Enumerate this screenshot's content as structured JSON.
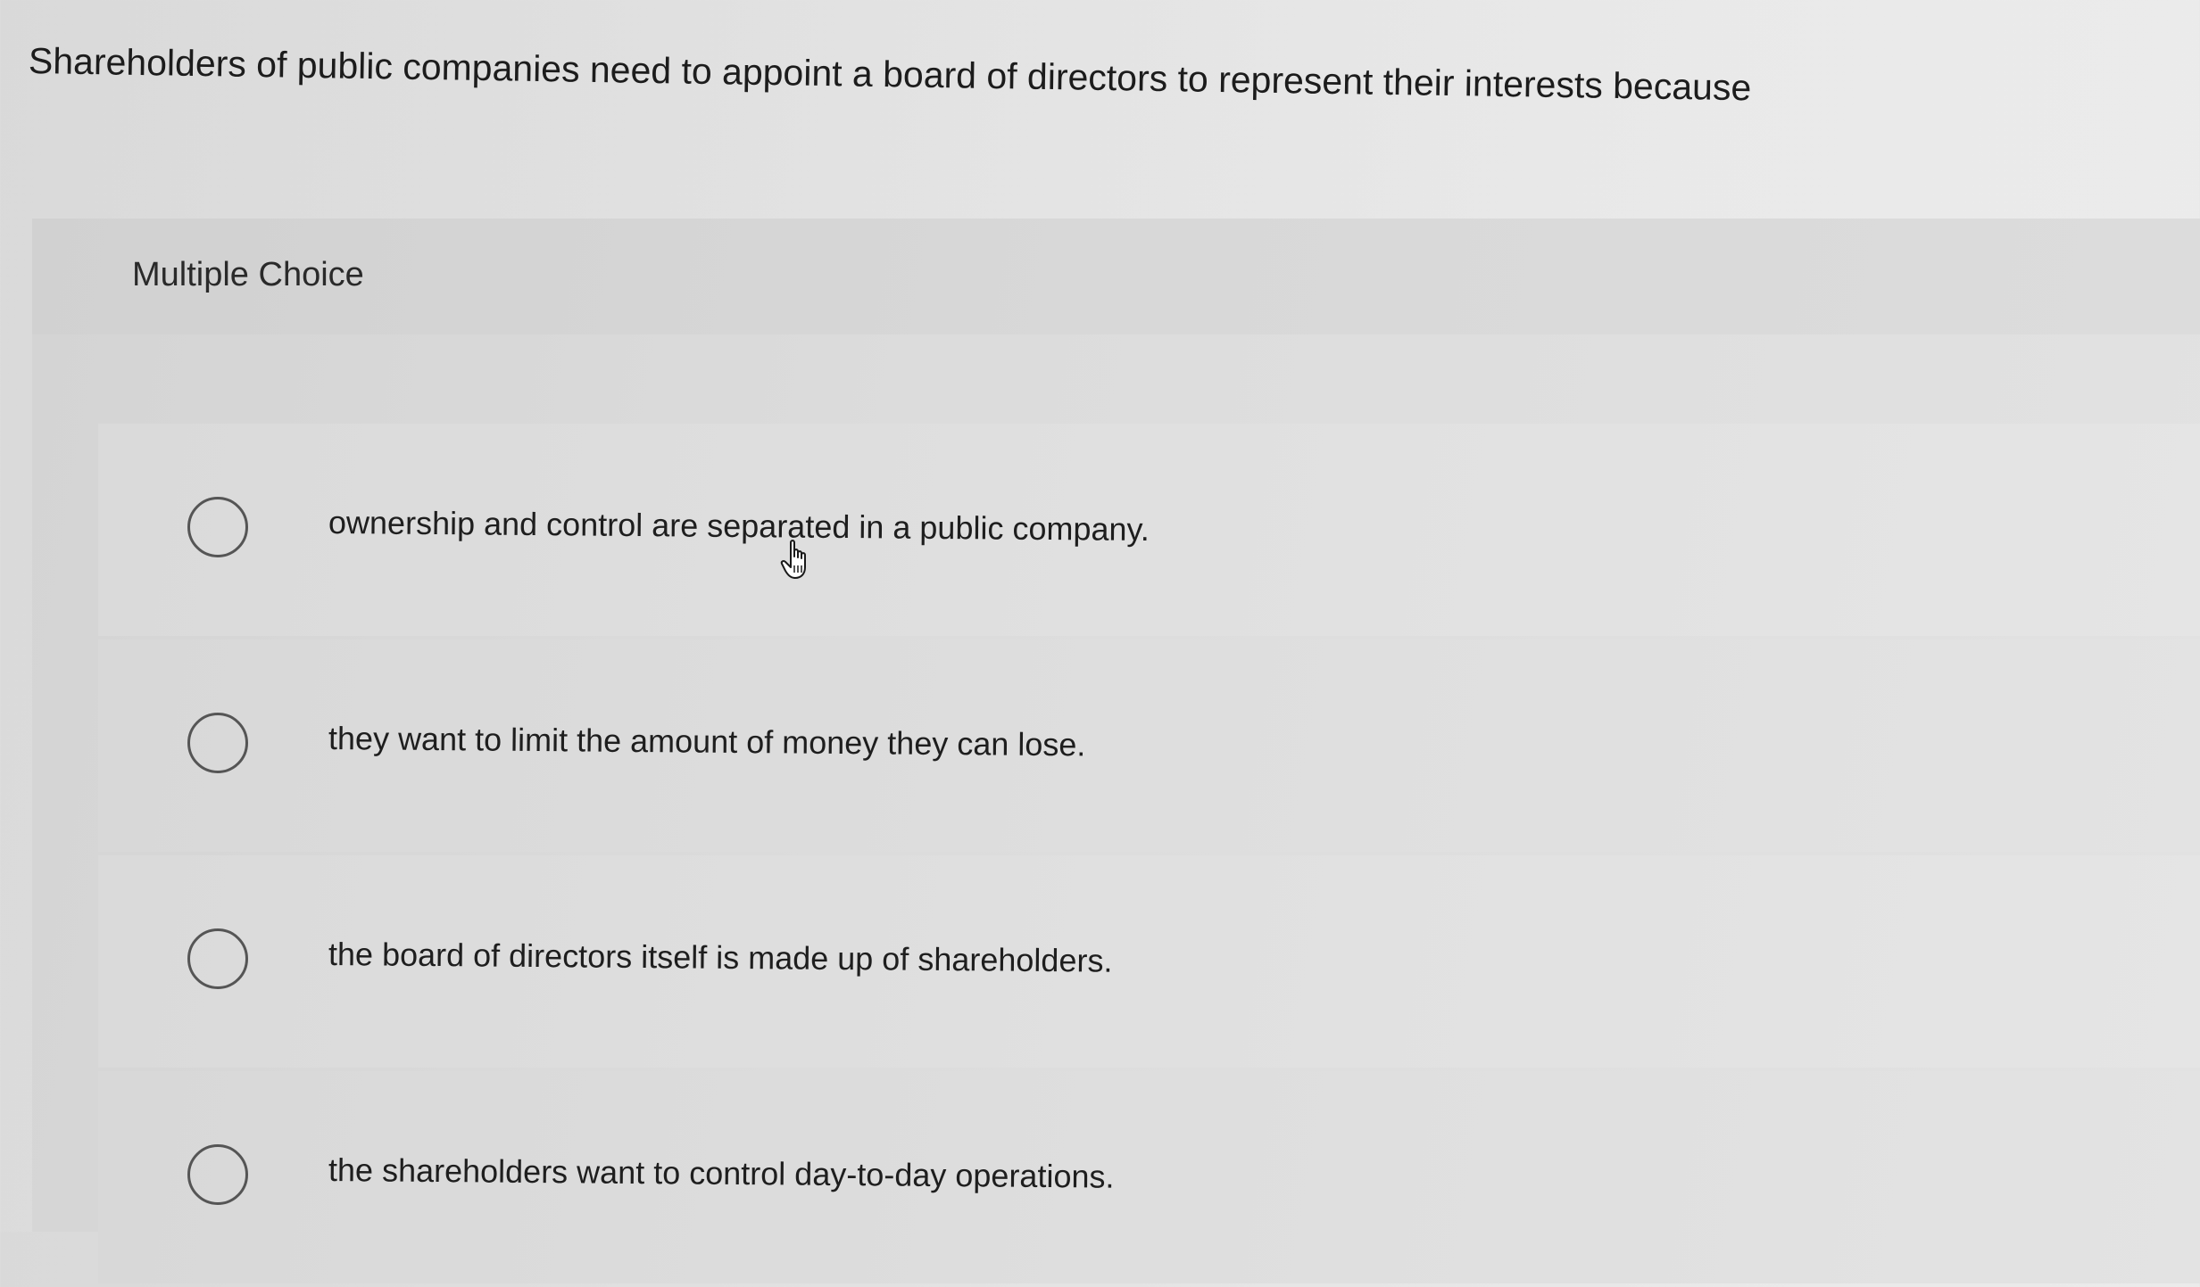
{
  "question": {
    "text": "Shareholders of public companies need to appoint a board of directors to represent their interests because"
  },
  "question_type": {
    "label": "Multiple Choice"
  },
  "options": [
    {
      "text": "ownership and control are separated in a public company.",
      "selected": false
    },
    {
      "text": "they want to limit the amount of money they can lose.",
      "selected": false
    },
    {
      "text": "the board of directors itself is made up of shareholders.",
      "selected": false
    },
    {
      "text": "the shareholders want to control day-to-day operations.",
      "selected": false
    }
  ],
  "cursor": {
    "icon": "hand-pointer-icon"
  }
}
